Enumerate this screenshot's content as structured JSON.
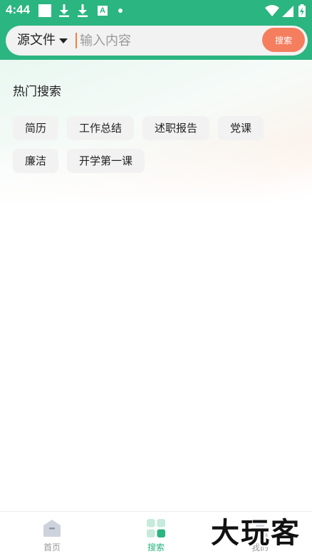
{
  "status_bar": {
    "time": "4:44",
    "icons": [
      "notification-square-icon",
      "download-icon",
      "download-icon",
      "a-icon",
      "dot-icon",
      "wifi-icon",
      "signal-icon",
      "battery-icon"
    ]
  },
  "search": {
    "source_label": "源文件",
    "placeholder": "输入内容",
    "button_label": "搜索"
  },
  "hot_search": {
    "title": "热门搜索",
    "tags": [
      "简历",
      "工作总结",
      "述职报告",
      "党课",
      "廉洁",
      "开学第一课"
    ]
  },
  "bottom_nav": {
    "items": [
      {
        "label": "首页",
        "icon": "home-icon",
        "active": false
      },
      {
        "label": "搜索",
        "icon": "search-grid-icon",
        "active": true
      },
      {
        "label": "我的",
        "icon": "profile-icon",
        "active": false
      }
    ]
  },
  "watermark": {
    "text": "大玩客"
  },
  "colors": {
    "brand_green": "#2bb580",
    "search_button": "#f57e5f",
    "tag_background": "#f2f2f2"
  }
}
